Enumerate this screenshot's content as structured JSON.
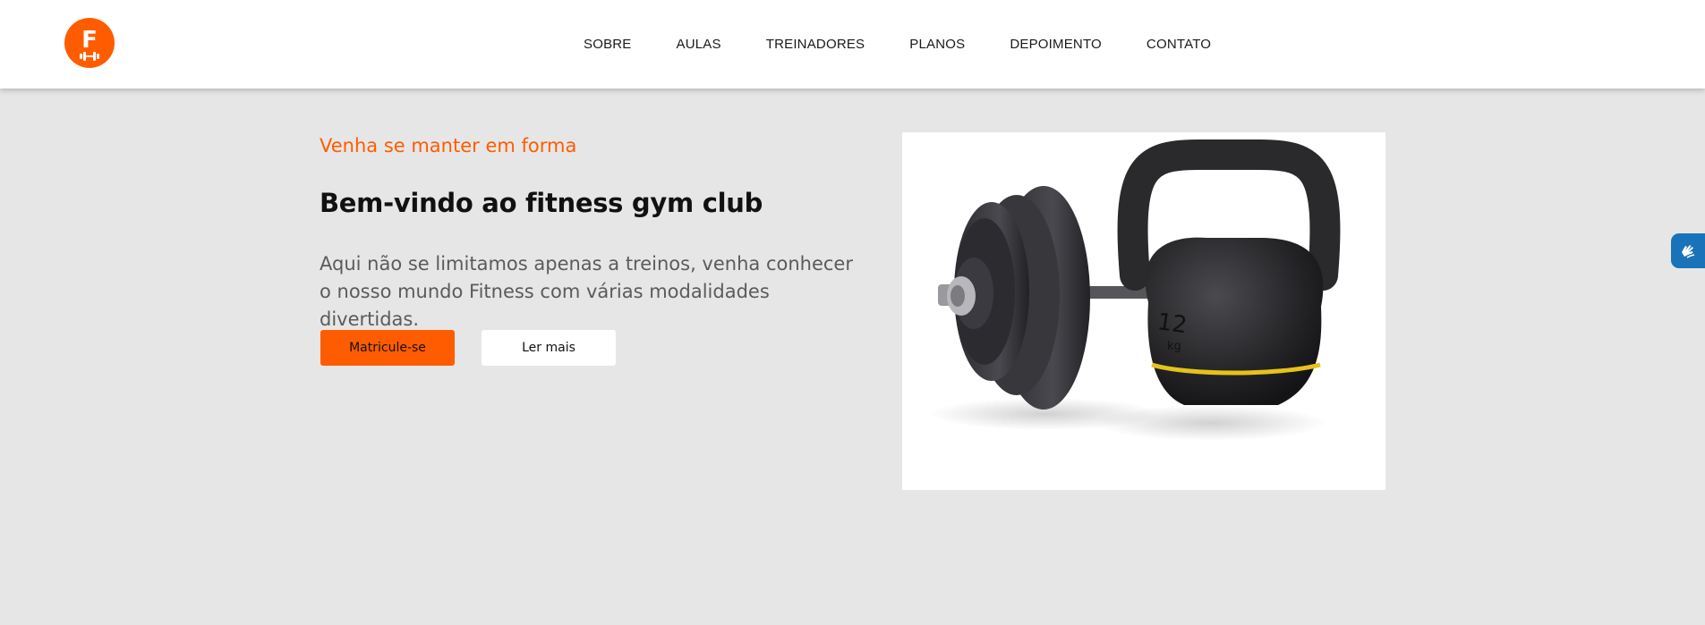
{
  "header": {
    "logo_letter": "F",
    "nav": [
      "SOBRE",
      "AULAS",
      "TREINADORES",
      "PLANOS",
      "DEPOIMENTO",
      "CONTATO"
    ]
  },
  "hero": {
    "subtitle": "Venha se manter em forma",
    "title": "Bem-vindo ao fitness gym club",
    "text": "Aqui não se limitamos apenas a treinos, venha conhecer o nosso mundo Fitness com várias modalidades divertidas.",
    "primary_button": "Matricule-se",
    "secondary_button": "Ler mais",
    "image": {
      "depicts": "dumbbell-and-kettlebell",
      "kettlebell_label": "12",
      "kettlebell_unit": "kg"
    }
  },
  "widgets": {
    "accessibility_icon": "sign-language-icon"
  },
  "colors": {
    "accent": "#ff5c00",
    "background": "#e6e6e6",
    "header_bg": "#ffffff",
    "widget": "#1a73b8"
  }
}
